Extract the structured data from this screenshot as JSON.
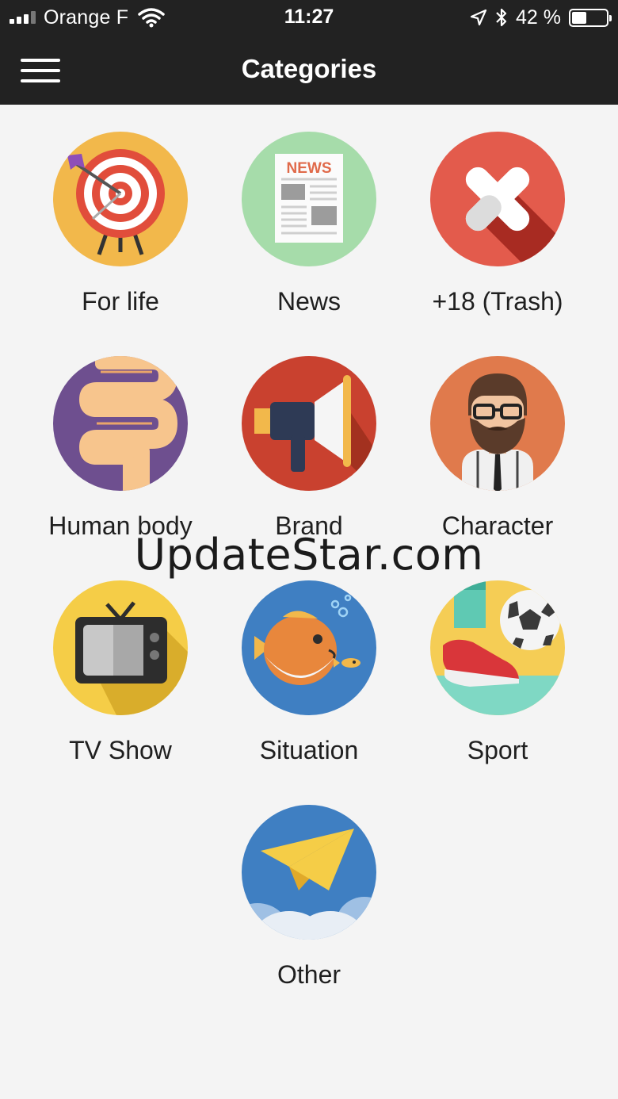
{
  "status": {
    "carrier": "Orange F",
    "time": "11:27",
    "battery_percent": "42 %",
    "battery_level": 0.42,
    "icons": [
      "signal-icon",
      "wifi-icon",
      "location-icon",
      "bluetooth-icon",
      "battery-icon"
    ]
  },
  "header": {
    "title": "Categories",
    "menu_icon": "hamburger-menu-icon"
  },
  "categories": [
    {
      "label": "For life",
      "icon": "target-icon",
      "color": "#f2b84b"
    },
    {
      "label": "News",
      "icon": "newspaper-icon",
      "color": "#a6dcaa"
    },
    {
      "label": "+18 (Trash)",
      "icon": "x-mark-icon",
      "color": "#e35b4c"
    },
    {
      "label": "Human body",
      "icon": "intestine-icon",
      "color": "#6e4f8f"
    },
    {
      "label": "Brand",
      "icon": "megaphone-icon",
      "color": "#c9412f"
    },
    {
      "label": "Character",
      "icon": "bearded-man-icon",
      "color": "#e07a4c"
    },
    {
      "label": "TV Show",
      "icon": "tv-icon",
      "color": "#f5cd47"
    },
    {
      "label": "Situation",
      "icon": "fish-icon",
      "color": "#3f7fc2"
    },
    {
      "label": "Sport",
      "icon": "soccer-icon",
      "color": "#f5cd55"
    },
    {
      "label": "Other",
      "icon": "paper-plane-icon",
      "color": "#3f7fc2"
    }
  ],
  "news_icon_text": "NEWS",
  "watermark": "UpdateStar.com"
}
